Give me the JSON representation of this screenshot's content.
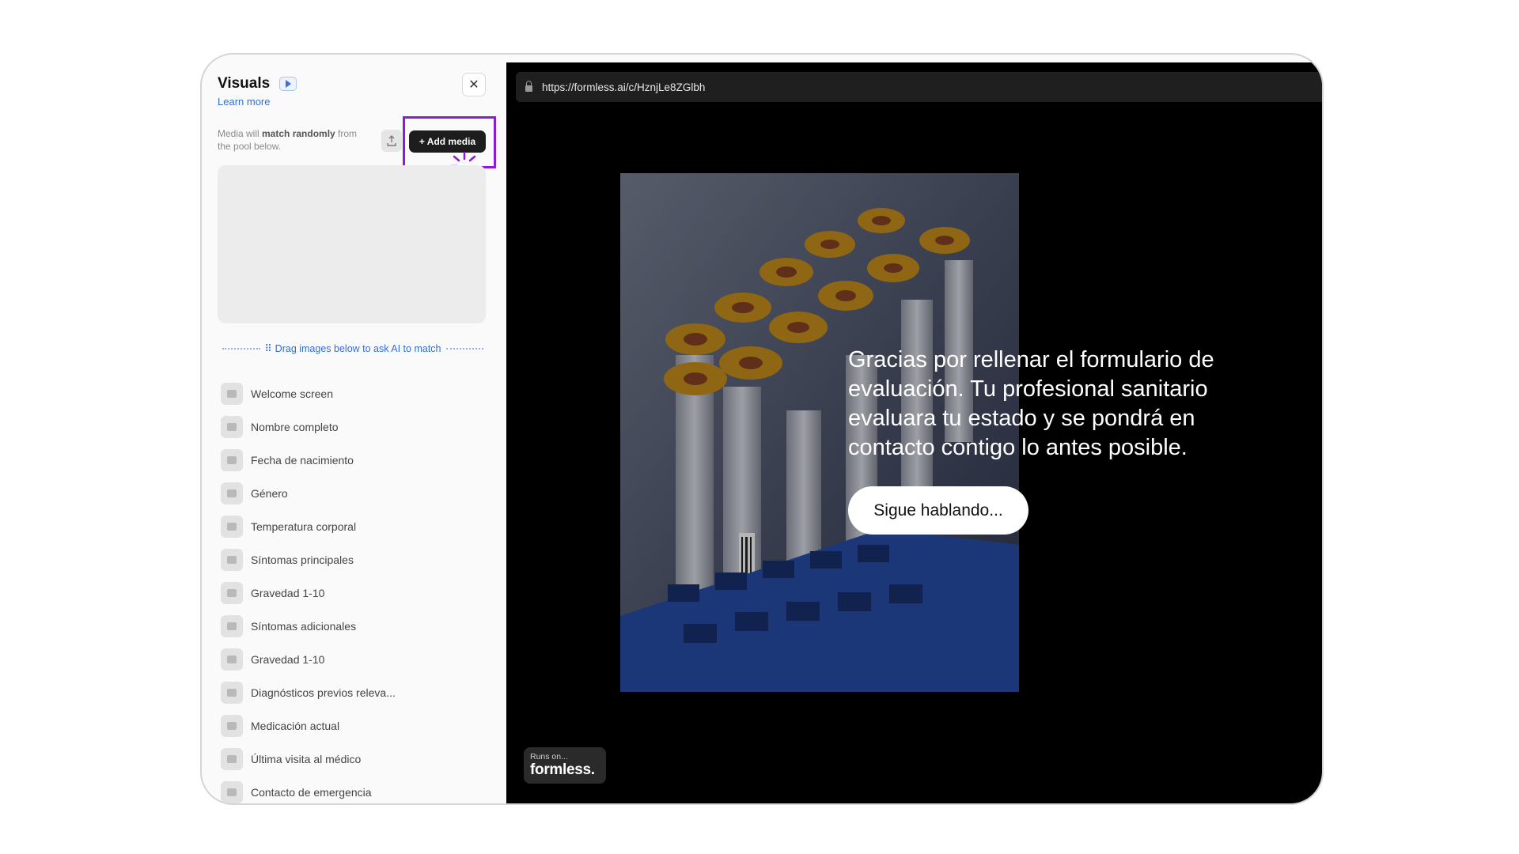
{
  "sidebar": {
    "title": "Visuals",
    "learn_more": "Learn more",
    "hint_prefix": "Media will ",
    "hint_bold": "match randomly",
    "hint_suffix": " from the pool below.",
    "add_media_label": "+ Add media",
    "drag_hint": "Drag images below to ask AI to match",
    "items": [
      {
        "label": "Welcome screen"
      },
      {
        "label": "Nombre completo"
      },
      {
        "label": "Fecha de nacimiento"
      },
      {
        "label": "Género"
      },
      {
        "label": "Temperatura corporal"
      },
      {
        "label": "Síntomas principales"
      },
      {
        "label": "Gravedad 1-10"
      },
      {
        "label": "Síntomas adicionales"
      },
      {
        "label": "Gravedad 1-10"
      },
      {
        "label": "Diagnósticos previos releva..."
      },
      {
        "label": "Medicación actual"
      },
      {
        "label": "Última visita al médico"
      },
      {
        "label": "Contacto de emergencia"
      }
    ]
  },
  "preview": {
    "url": "https://formless.ai/c/HznjLe8ZGlbh",
    "message": "Gracias por rellenar el formulario de evaluación. Tu profesional sanitario evaluara tu estado y se pondrá en contacto contigo lo antes posible.",
    "cta_label": "Sigue hablando...",
    "badge_small": "Runs on...",
    "badge_brand": "formless."
  },
  "colors": {
    "highlight": "#8e19d6",
    "link": "#2f6fdb",
    "preview_bg": "#000000"
  },
  "icons": [
    "play-icon",
    "close-icon",
    "upload-icon",
    "cursor-icon",
    "grip-icon",
    "image-icon",
    "lock-icon"
  ]
}
